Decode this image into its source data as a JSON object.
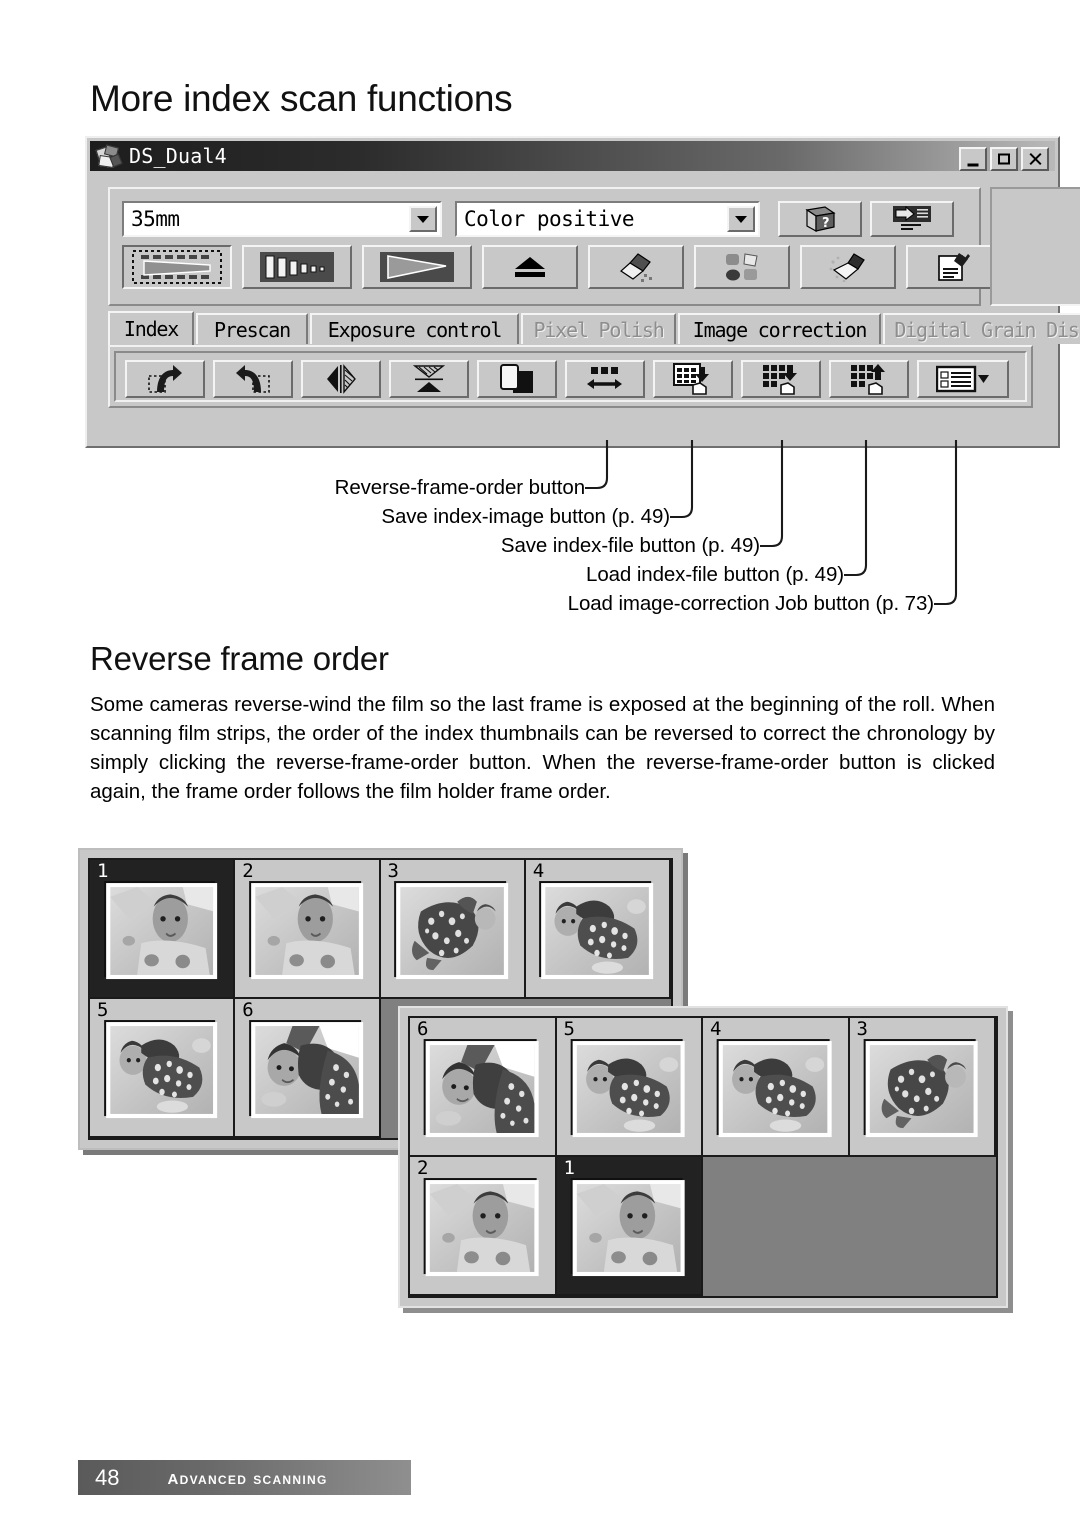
{
  "page": {
    "title": "More index scan functions",
    "footer_page_number": "48",
    "footer_section": "Advanced scanning"
  },
  "window": {
    "title": "DS_Dual4",
    "icon": "scanner-film-icon",
    "controls": [
      {
        "name": "minimize",
        "glyph": "minimize-icon"
      },
      {
        "name": "maximize",
        "glyph": "maximize-icon"
      },
      {
        "name": "close",
        "glyph": "close-icon"
      }
    ],
    "combos": [
      {
        "name": "film-format",
        "value": "35mm"
      },
      {
        "name": "film-type",
        "value": "Color positive"
      }
    ],
    "main_toolbar_row1": [
      {
        "name": "help-button",
        "icon": "help-book-icon"
      },
      {
        "name": "preferences-button",
        "icon": "preferences-icon"
      }
    ],
    "main_toolbar_row2": [
      {
        "name": "index-scan-button",
        "icon": "index-scan-icon",
        "pressed": true
      },
      {
        "name": "prescan-button",
        "icon": "prescan-icon",
        "pressed": false
      },
      {
        "name": "scan-button",
        "icon": "scan-icon",
        "pressed": false
      },
      {
        "name": "eject-button",
        "icon": "eject-icon",
        "pressed": false
      },
      {
        "name": "dust-brush-button",
        "icon": "dust-brush-icon",
        "pressed": false
      },
      {
        "name": "color-match-button",
        "icon": "color-match-icon",
        "pressed": false
      },
      {
        "name": "grain-dissolver-button",
        "icon": "grain-dissolver-icon",
        "pressed": false
      },
      {
        "name": "job-settings-button",
        "icon": "job-settings-icon",
        "pressed": false
      }
    ],
    "tabs": [
      {
        "label": "Index",
        "active": true,
        "disabled": false
      },
      {
        "label": "Prescan",
        "active": false,
        "disabled": false
      },
      {
        "label": "Exposure control",
        "active": false,
        "disabled": false
      },
      {
        "label": "Pixel Polish",
        "active": false,
        "disabled": true
      },
      {
        "label": "Image correction",
        "active": false,
        "disabled": false
      },
      {
        "label": "Digital Grain Dissolver",
        "active": false,
        "disabled": true
      }
    ],
    "index_toolbar": [
      {
        "name": "rotate-left-button",
        "icon": "rotate-left-icon"
      },
      {
        "name": "rotate-right-button",
        "icon": "rotate-right-icon"
      },
      {
        "name": "flip-horizontal-button",
        "icon": "flip-horizontal-icon"
      },
      {
        "name": "flip-vertical-button",
        "icon": "flip-vertical-icon"
      },
      {
        "name": "invert-button",
        "icon": "invert-icon"
      },
      {
        "name": "reverse-frame-order-button",
        "icon": "reverse-frame-order-icon"
      },
      {
        "name": "save-index-image-button",
        "icon": "save-index-image-icon"
      },
      {
        "name": "save-index-file-button",
        "icon": "save-index-file-icon"
      },
      {
        "name": "load-index-file-button",
        "icon": "load-index-file-icon"
      },
      {
        "name": "load-job-button",
        "icon": "load-job-icon"
      }
    ]
  },
  "callouts": [
    {
      "label": "Reverse-frame-order button"
    },
    {
      "label": "Save index-image button (p. 49)"
    },
    {
      "label": "Save index-file button (p. 49)"
    },
    {
      "label": "Load index-file button (p. 49)"
    },
    {
      "label": "Load image-correction Job button (p. 73)"
    }
  ],
  "section": {
    "heading": "Reverse frame order",
    "body": "Some cameras reverse-wind the film so the last frame is exposed at the beginning of the roll. When scanning film strips, the order of the index thumbnails can be reversed to correct the chronology by simply clicking the reverse-frame-order button. When the reverse-frame-order button is clicked again, the frame order follows the film holder frame order."
  },
  "thumbnail_panels": [
    {
      "name": "index-panel-normal-order",
      "cells": [
        {
          "number": "1",
          "selected": true,
          "empty": false,
          "photo": "baby-face"
        },
        {
          "number": "2",
          "selected": false,
          "empty": false,
          "photo": "baby-face"
        },
        {
          "number": "3",
          "selected": false,
          "empty": false,
          "photo": "baby-sprawl"
        },
        {
          "number": "4",
          "selected": false,
          "empty": false,
          "photo": "baby-wrapped"
        },
        {
          "number": "5",
          "selected": false,
          "empty": false,
          "photo": "baby-wrapped"
        },
        {
          "number": "6",
          "selected": false,
          "empty": false,
          "photo": "baby-blanket"
        },
        {
          "number": "",
          "selected": false,
          "empty": true,
          "photo": ""
        },
        {
          "number": "",
          "selected": false,
          "empty": true,
          "photo": ""
        }
      ]
    },
    {
      "name": "index-panel-reversed-order",
      "cells": [
        {
          "number": "6",
          "selected": false,
          "empty": false,
          "photo": "baby-blanket"
        },
        {
          "number": "5",
          "selected": false,
          "empty": false,
          "photo": "baby-wrapped"
        },
        {
          "number": "4",
          "selected": false,
          "empty": false,
          "photo": "baby-wrapped"
        },
        {
          "number": "3",
          "selected": false,
          "empty": false,
          "photo": "baby-sprawl"
        },
        {
          "number": "2",
          "selected": false,
          "empty": false,
          "photo": "baby-face"
        },
        {
          "number": "1",
          "selected": true,
          "empty": false,
          "photo": "baby-face"
        },
        {
          "number": "",
          "selected": false,
          "empty": true,
          "photo": ""
        },
        {
          "number": "",
          "selected": false,
          "empty": true,
          "photo": ""
        }
      ]
    }
  ]
}
